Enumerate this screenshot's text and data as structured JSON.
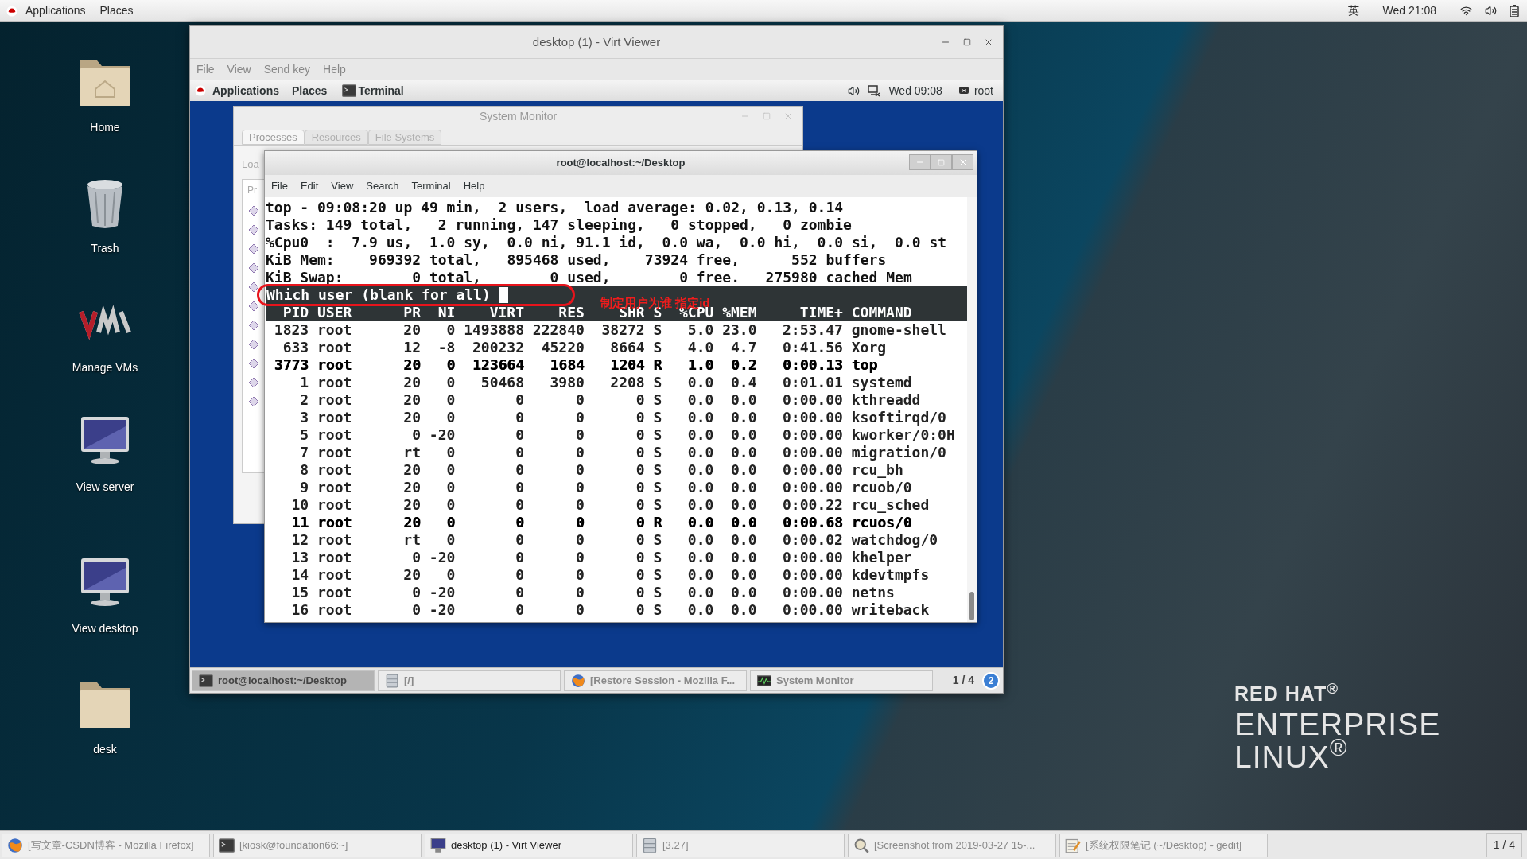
{
  "top_bar": {
    "menus": [
      "Applications",
      "Places"
    ],
    "input_method": "英",
    "clock": "Wed 21:08"
  },
  "desktop_icons": [
    {
      "label": "Home",
      "kind": "home-folder"
    },
    {
      "label": "Trash",
      "kind": "trash"
    },
    {
      "label": "Manage VMs",
      "kind": "vm"
    },
    {
      "label": "View server",
      "kind": "monitor"
    },
    {
      "label": "View desktop",
      "kind": "monitor"
    },
    {
      "label": "desk",
      "kind": "folder"
    }
  ],
  "virt_viewer": {
    "title": "desktop (1) - Virt Viewer",
    "menu": [
      "File",
      "View",
      "Send key",
      "Help"
    ],
    "guest": {
      "top_bar": {
        "menus": [
          "Applications",
          "Places"
        ],
        "app": "Terminal",
        "clock": "Wed 09:08",
        "user": "root"
      },
      "system_monitor": {
        "title": "System Monitor",
        "tabs": [
          {
            "label": "Processes",
            "selected": true
          },
          {
            "label": "Resources",
            "selected": false
          },
          {
            "label": "File Systems",
            "selected": false
          }
        ],
        "side_label": "Loa",
        "column_label": "Pr"
      },
      "terminal": {
        "title": "root@localhost:~/Desktop",
        "menu": [
          "File",
          "Edit",
          "View",
          "Search",
          "Terminal",
          "Help"
        ],
        "summary": [
          "top - 09:08:20 up 49 min,  2 users,  load average: 0.02, 0.13, 0.14",
          "Tasks: 149 total,   2 running, 147 sleeping,   0 stopped,   0 zombie",
          "%Cpu0  :  7.9 us,  1.0 sy,  0.0 ni, 91.1 id,  0.0 wa,  0.0 hi,  0.0 si,  0.0 st",
          "KiB Mem:    969392 total,   895468 used,    73924 free,      552 buffers",
          "KiB Swap:        0 total,        0 used,        0 free.   275980 cached Mem"
        ],
        "prompt": "Which user (blank for all)",
        "annotation": "制定用户为谁 指定id",
        "columns": [
          "PID",
          "USER",
          "PR",
          "NI",
          "VIRT",
          "RES",
          "SHR",
          "S",
          "%CPU",
          "%MEM",
          "TIME+",
          "COMMAND"
        ],
        "rows": [
          {
            "cells": [
              "1823",
              "root",
              "20",
              "0",
              "1493888",
              "222840",
              "38272",
              "S",
              "5.0",
              "23.0",
              "2:53.47",
              "gnome-shell"
            ],
            "highlighted": false
          },
          {
            "cells": [
              "633",
              "root",
              "12",
              "-8",
              "200232",
              "45220",
              "8664",
              "S",
              "4.0",
              "4.7",
              "0:41.56",
              "Xorg"
            ],
            "highlighted": false
          },
          {
            "cells": [
              "3773",
              "root",
              "20",
              "0",
              "123664",
              "1684",
              "1204",
              "R",
              "1.0",
              "0.2",
              "0:00.13",
              "top"
            ],
            "highlighted": true
          },
          {
            "cells": [
              "1",
              "root",
              "20",
              "0",
              "50468",
              "3980",
              "2208",
              "S",
              "0.0",
              "0.4",
              "0:01.01",
              "systemd"
            ],
            "highlighted": false
          },
          {
            "cells": [
              "2",
              "root",
              "20",
              "0",
              "0",
              "0",
              "0",
              "S",
              "0.0",
              "0.0",
              "0:00.00",
              "kthreadd"
            ],
            "highlighted": false
          },
          {
            "cells": [
              "3",
              "root",
              "20",
              "0",
              "0",
              "0",
              "0",
              "S",
              "0.0",
              "0.0",
              "0:00.00",
              "ksoftirqd/0"
            ],
            "highlighted": false
          },
          {
            "cells": [
              "5",
              "root",
              "0",
              "-20",
              "0",
              "0",
              "0",
              "S",
              "0.0",
              "0.0",
              "0:00.00",
              "kworker/0:0H"
            ],
            "highlighted": false
          },
          {
            "cells": [
              "7",
              "root",
              "rt",
              "0",
              "0",
              "0",
              "0",
              "S",
              "0.0",
              "0.0",
              "0:00.00",
              "migration/0"
            ],
            "highlighted": false
          },
          {
            "cells": [
              "8",
              "root",
              "20",
              "0",
              "0",
              "0",
              "0",
              "S",
              "0.0",
              "0.0",
              "0:00.00",
              "rcu_bh"
            ],
            "highlighted": false
          },
          {
            "cells": [
              "9",
              "root",
              "20",
              "0",
              "0",
              "0",
              "0",
              "S",
              "0.0",
              "0.0",
              "0:00.00",
              "rcuob/0"
            ],
            "highlighted": false
          },
          {
            "cells": [
              "10",
              "root",
              "20",
              "0",
              "0",
              "0",
              "0",
              "S",
              "0.0",
              "0.0",
              "0:00.22",
              "rcu_sched"
            ],
            "highlighted": false
          },
          {
            "cells": [
              "11",
              "root",
              "20",
              "0",
              "0",
              "0",
              "0",
              "R",
              "0.0",
              "0.0",
              "0:00.68",
              "rcuos/0"
            ],
            "highlighted": true
          },
          {
            "cells": [
              "12",
              "root",
              "rt",
              "0",
              "0",
              "0",
              "0",
              "S",
              "0.0",
              "0.0",
              "0:00.02",
              "watchdog/0"
            ],
            "highlighted": false
          },
          {
            "cells": [
              "13",
              "root",
              "0",
              "-20",
              "0",
              "0",
              "0",
              "S",
              "0.0",
              "0.0",
              "0:00.00",
              "khelper"
            ],
            "highlighted": false
          },
          {
            "cells": [
              "14",
              "root",
              "20",
              "0",
              "0",
              "0",
              "0",
              "S",
              "0.0",
              "0.0",
              "0:00.00",
              "kdevtmpfs"
            ],
            "highlighted": false
          },
          {
            "cells": [
              "15",
              "root",
              "0",
              "-20",
              "0",
              "0",
              "0",
              "S",
              "0.0",
              "0.0",
              "0:00.00",
              "netns"
            ],
            "highlighted": false
          },
          {
            "cells": [
              "16",
              "root",
              "0",
              "-20",
              "0",
              "0",
              "0",
              "S",
              "0.0",
              "0.0",
              "0:00.00",
              "writeback"
            ],
            "highlighted": false
          }
        ]
      },
      "taskbar": {
        "items": [
          {
            "label": "root@localhost:~/Desktop",
            "kind": "terminal",
            "selected": true
          },
          {
            "label": "[/]",
            "kind": "files",
            "selected": false
          },
          {
            "label": "[Restore Session - Mozilla F...",
            "kind": "browser",
            "selected": false
          },
          {
            "label": "System Monitor",
            "kind": "monitor",
            "selected": false
          }
        ],
        "pager": "1 / 4",
        "badge": "2"
      }
    }
  },
  "taskbar": {
    "items": [
      {
        "label": "[写文章-CSDN博客 - Mozilla Firefox]",
        "kind": "browser",
        "minimized": true
      },
      {
        "label": "[kiosk@foundation66:~]",
        "kind": "terminal",
        "minimized": true
      },
      {
        "label": "desktop (1) - Virt Viewer",
        "kind": "display",
        "minimized": false
      },
      {
        "label": "[3.27]",
        "kind": "files",
        "minimized": true
      },
      {
        "label": "[Screenshot from 2019-03-27 15-...",
        "kind": "screenshot",
        "minimized": true
      },
      {
        "label": "[系统权限笔记 (~/Desktop) - gedit]",
        "kind": "editor",
        "minimized": true
      }
    ],
    "pager": "1 / 4"
  },
  "logo": {
    "lines": [
      "RED HAT$^{®}$",
      "ENTERPRISE",
      "LINUX$^{®}$"
    ]
  }
}
